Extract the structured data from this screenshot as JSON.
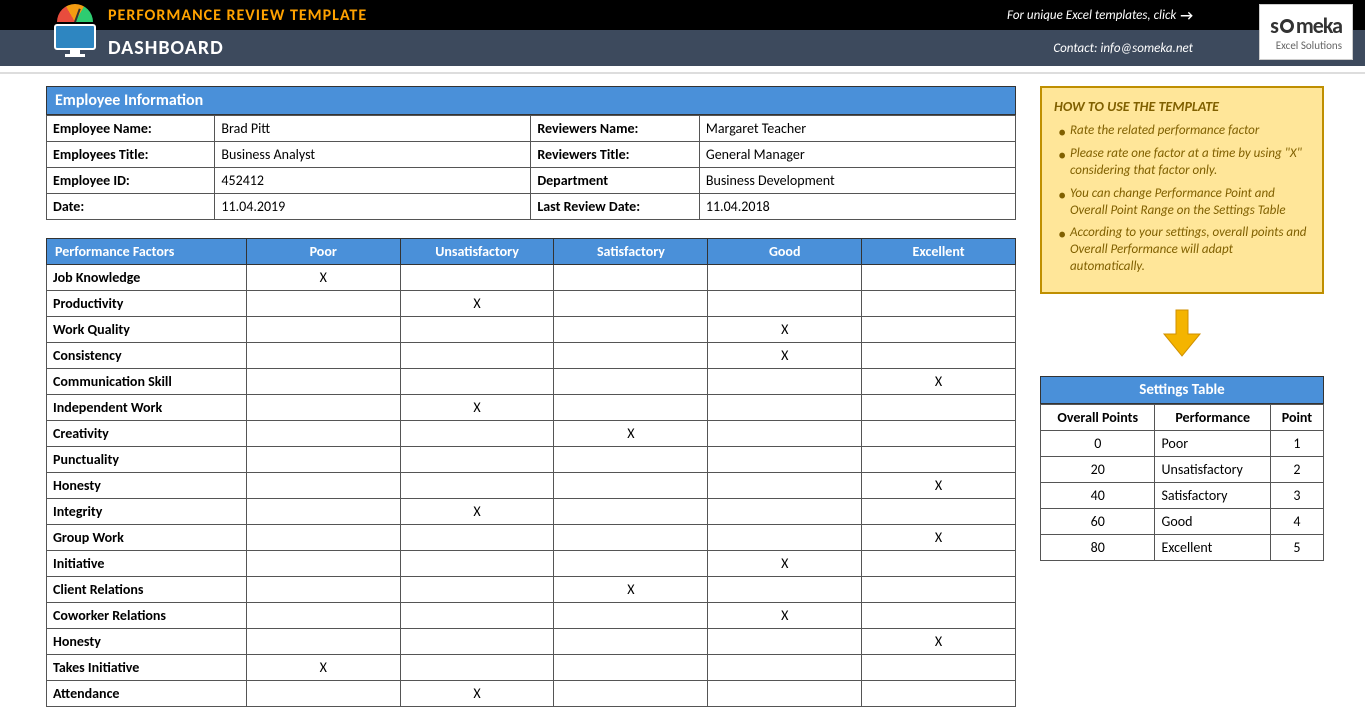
{
  "header": {
    "title": "PERFORMANCE REVIEW TEMPLATE",
    "link_text": "For unique Excel templates, click",
    "dashboard": "DASHBOARD",
    "contact": "Contact: info@someka.net",
    "brand": "someka",
    "brand_tag": "Excel Solutions"
  },
  "emp_info": {
    "header": "Employee Information",
    "rows": [
      {
        "l1": "Employee Name:",
        "v1": "Brad Pitt",
        "l2": "Reviewers Name:",
        "v2": "Margaret Teacher"
      },
      {
        "l1": "Employees Title:",
        "v1": "Business Analyst",
        "l2": "Reviewers Title:",
        "v2": "General Manager"
      },
      {
        "l1": "Employee ID:",
        "v1": "452412",
        "l2": "Department",
        "v2": "Business Development"
      },
      {
        "l1": "Date:",
        "v1": "11.04.2019",
        "l2": "Last Review Date:",
        "v2": "11.04.2018"
      }
    ]
  },
  "factors": {
    "header": "Performance Factors",
    "ratings": [
      "Poor",
      "Unsatisfactory",
      "Satisfactory",
      "Good",
      "Excellent"
    ],
    "rows": [
      {
        "name": "Job Knowledge",
        "marks": [
          "X",
          "",
          "",
          "",
          ""
        ]
      },
      {
        "name": "Productivity",
        "marks": [
          "",
          "X",
          "",
          "",
          ""
        ]
      },
      {
        "name": "Work Quality",
        "marks": [
          "",
          "",
          "",
          "X",
          ""
        ]
      },
      {
        "name": "Consistency",
        "marks": [
          "",
          "",
          "",
          "X",
          ""
        ]
      },
      {
        "name": "Communication Skill",
        "marks": [
          "",
          "",
          "",
          "",
          "X"
        ]
      },
      {
        "name": "Independent Work",
        "marks": [
          "",
          "X",
          "",
          "",
          ""
        ]
      },
      {
        "name": "Creativity",
        "marks": [
          "",
          "",
          "X",
          "",
          ""
        ]
      },
      {
        "name": "Punctuality",
        "marks": [
          "",
          "",
          "",
          "",
          ""
        ]
      },
      {
        "name": "Honesty",
        "marks": [
          "",
          "",
          "",
          "",
          "X"
        ]
      },
      {
        "name": "Integrity",
        "marks": [
          "",
          "X",
          "",
          "",
          ""
        ]
      },
      {
        "name": "Group Work",
        "marks": [
          "",
          "",
          "",
          "",
          "X"
        ]
      },
      {
        "name": "Initiative",
        "marks": [
          "",
          "",
          "",
          "X",
          ""
        ]
      },
      {
        "name": "Client Relations",
        "marks": [
          "",
          "",
          "X",
          "",
          ""
        ]
      },
      {
        "name": "Coworker Relations",
        "marks": [
          "",
          "",
          "",
          "X",
          ""
        ]
      },
      {
        "name": "Honesty",
        "marks": [
          "",
          "",
          "",
          "",
          "X"
        ]
      },
      {
        "name": "Takes Initiative",
        "marks": [
          "X",
          "",
          "",
          "",
          ""
        ]
      },
      {
        "name": "Attendance",
        "marks": [
          "",
          "X",
          "",
          "",
          ""
        ]
      }
    ]
  },
  "howto": {
    "title": "HOW TO USE THE TEMPLATE",
    "items": [
      "Rate the related performance factor",
      "Please rate one factor at a time by using \"X\" considering that factor only.",
      "You can change Performance Point and Overall Point Range on the Settings Table",
      "According to your settings, overall points and Overall Performance will adapt automatically."
    ]
  },
  "settings": {
    "header": "Settings Table",
    "cols": [
      "Overall Points",
      "Performance",
      "Point"
    ],
    "rows": [
      {
        "op": "0",
        "perf": "Poor",
        "pt": "1"
      },
      {
        "op": "20",
        "perf": "Unsatisfactory",
        "pt": "2"
      },
      {
        "op": "40",
        "perf": "Satisfactory",
        "pt": "3"
      },
      {
        "op": "60",
        "perf": "Good",
        "pt": "4"
      },
      {
        "op": "80",
        "perf": "Excellent",
        "pt": "5"
      }
    ]
  }
}
